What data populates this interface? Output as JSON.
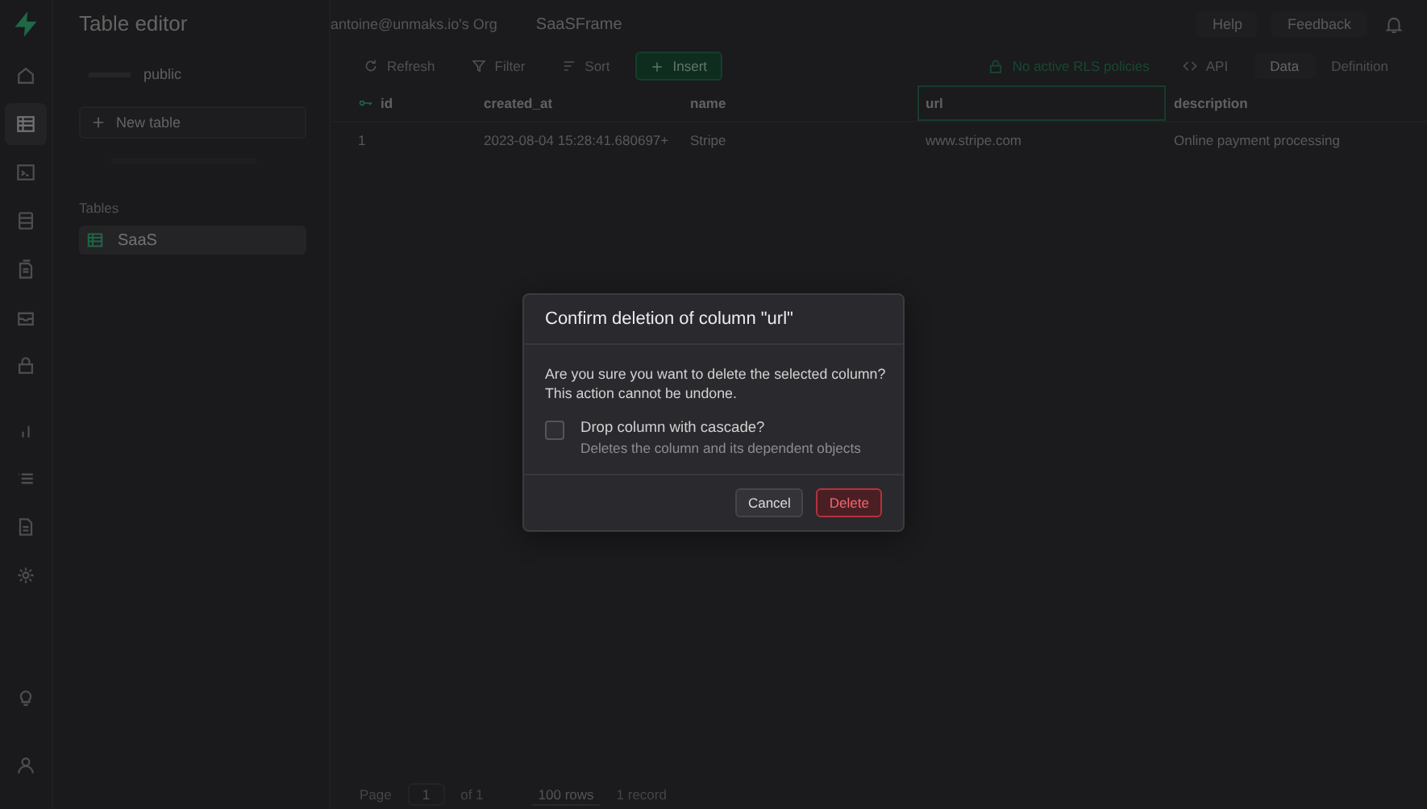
{
  "nav_items": [
    {
      "kind": "home",
      "selected": false
    },
    {
      "kind": "table",
      "selected": true
    },
    {
      "kind": "terminal",
      "selected": false
    },
    {
      "kind": "database",
      "selected": false
    },
    {
      "kind": "file",
      "selected": false
    },
    {
      "kind": "inbox",
      "selected": false
    },
    {
      "kind": "lock",
      "selected": false
    },
    {
      "kind": "chart",
      "selected": false
    },
    {
      "kind": "list",
      "selected": false
    },
    {
      "kind": "document",
      "selected": false
    },
    {
      "kind": "gear",
      "selected": false
    }
  ],
  "nav_footer": [
    {
      "kind": "bulb"
    },
    {
      "kind": "user"
    }
  ],
  "sidebar": {
    "title": "Table editor",
    "schema": "public",
    "new_table": "New table",
    "section_label": "Tables",
    "tables": [
      {
        "name": "SaaS",
        "selected": true
      }
    ]
  },
  "top_bar": {
    "breadcrumbs": [
      "antoine@unmaks.io's Org",
      "SaaSFrame"
    ],
    "help": "Help",
    "feedback": "Feedback"
  },
  "toolbar": {
    "refresh": "Refresh",
    "filter": "Filter",
    "sort": "Sort",
    "insert": "Insert",
    "rls_notice": "No active RLS policies",
    "api": "API",
    "tabs": [
      {
        "label": "Data",
        "selected": true
      },
      {
        "label": "Definition",
        "selected": false
      }
    ]
  },
  "table": {
    "columns": [
      {
        "name": "id",
        "primary_key": true,
        "selected": false
      },
      {
        "name": "created_at",
        "primary_key": false,
        "selected": false
      },
      {
        "name": "name",
        "primary_key": false,
        "selected": false
      },
      {
        "name": "url",
        "primary_key": false,
        "selected": true
      },
      {
        "name": "description",
        "primary_key": false,
        "selected": false
      }
    ],
    "rows": [
      [
        "1",
        "2023-08-04 15:28:41.680697+",
        "Stripe",
        "www.stripe.com",
        "Online payment processing"
      ]
    ]
  },
  "footer": {
    "page_label": "Page",
    "page": "1",
    "of": "of 1",
    "rows_per_page": "100 rows",
    "record_count": "1 record"
  },
  "dialog": {
    "title": "Confirm deletion of column \"url\"",
    "message": "Are you sure you want to delete the selected column?\nThis action cannot be undone.",
    "cascade": {
      "label": "Drop column with cascade?",
      "description": "Deletes the column and its dependent objects",
      "checked": false
    },
    "cancel": "Cancel",
    "confirm": "Delete"
  }
}
